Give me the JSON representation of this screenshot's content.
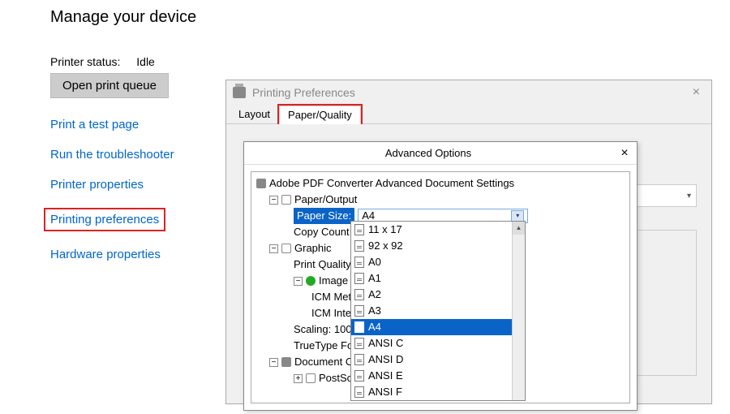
{
  "page": {
    "title": "Manage your device"
  },
  "status": {
    "label": "Printer status:",
    "value": "Idle"
  },
  "queue_button": "Open print queue",
  "links": {
    "test_page": "Print a test page",
    "troubleshooter": "Run the troubleshooter",
    "printer_properties": "Printer properties",
    "printing_preferences": "Printing preferences",
    "hardware_properties": "Hardware properties"
  },
  "prefs": {
    "title": "Printing Preferences",
    "tabs": {
      "layout": "Layout",
      "paper_quality": "Paper/Quality"
    }
  },
  "advanced": {
    "title": "Advanced Options",
    "root": "Adobe PDF Converter Advanced Document Settings",
    "paper_output": "Paper/Output",
    "paper_size_label": "Paper Size:",
    "paper_size_value": "A4",
    "copy_count": "Copy Count",
    "graphic": "Graphic",
    "print_quality": "Print Quality",
    "image_color": "Image Colo",
    "icm_meth": "ICM Meth",
    "icm_inten": "ICM Inten",
    "scaling": "Scaling: 100",
    "truetype": "TrueType Fo",
    "document_options": "Document Op",
    "postscript": "PostScript O",
    "dropdown": {
      "items": [
        "11 x 17",
        "92 x 92",
        "A0",
        "A1",
        "A2",
        "A3",
        "A4",
        "ANSI C",
        "ANSI D",
        "ANSI E",
        "ANSI F"
      ],
      "selected_index": 6
    }
  }
}
